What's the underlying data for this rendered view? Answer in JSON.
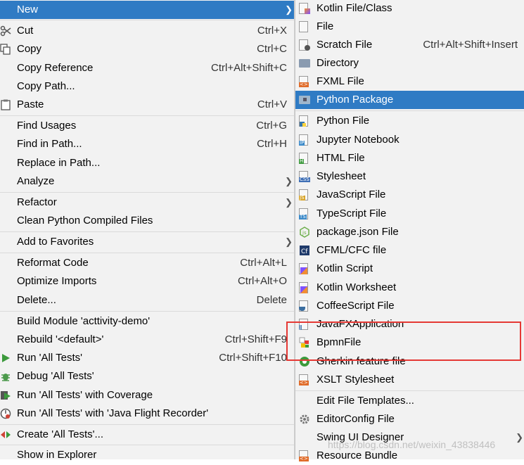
{
  "context_menu": {
    "items": [
      {
        "label": "New",
        "shortcut": "",
        "submenu": true,
        "selected": true
      },
      {
        "label": "Cut",
        "shortcut": "Ctrl+X",
        "icon": "scissors-icon"
      },
      {
        "label": "Copy",
        "shortcut": "Ctrl+C",
        "icon": "copy-icon"
      },
      {
        "label": "Copy Reference",
        "shortcut": "Ctrl+Alt+Shift+C"
      },
      {
        "label": "Copy Path...",
        "shortcut": ""
      },
      {
        "label": "Paste",
        "shortcut": "Ctrl+V",
        "icon": "clipboard-icon"
      },
      {
        "label": "Find Usages",
        "shortcut": "Ctrl+G"
      },
      {
        "label": "Find in Path...",
        "shortcut": "Ctrl+H"
      },
      {
        "label": "Replace in Path...",
        "shortcut": ""
      },
      {
        "label": "Analyze",
        "shortcut": "",
        "submenu": true
      },
      {
        "label": "Refactor",
        "shortcut": "",
        "submenu": true
      },
      {
        "label": "Clean Python Compiled Files",
        "shortcut": ""
      },
      {
        "label": "Add to Favorites",
        "shortcut": "",
        "submenu": true
      },
      {
        "label": "Reformat Code",
        "shortcut": "Ctrl+Alt+L"
      },
      {
        "label": "Optimize Imports",
        "shortcut": "Ctrl+Alt+O"
      },
      {
        "label": "Delete...",
        "shortcut": "Delete"
      },
      {
        "label": "Build Module 'acttivity-demo'",
        "shortcut": ""
      },
      {
        "label": "Rebuild '<default>'",
        "shortcut": "Ctrl+Shift+F9"
      },
      {
        "label": "Run 'All Tests'",
        "shortcut": "Ctrl+Shift+F10",
        "icon": "run-icon"
      },
      {
        "label": "Debug 'All Tests'",
        "shortcut": "",
        "icon": "debug-icon"
      },
      {
        "label": "Run 'All Tests' with Coverage",
        "shortcut": "",
        "icon": "coverage-icon"
      },
      {
        "label": "Run 'All Tests' with 'Java Flight Recorder'",
        "shortcut": "",
        "icon": "profiler-icon"
      },
      {
        "label": "Create 'All Tests'...",
        "shortcut": "",
        "icon": "create-test-icon"
      },
      {
        "label": "Show in Explorer",
        "shortcut": ""
      }
    ]
  },
  "submenu": {
    "items": [
      {
        "label": "Kotlin File/Class",
        "icon": "kotlin-file-icon"
      },
      {
        "label": "File",
        "icon": "file-icon"
      },
      {
        "label": "Scratch File",
        "shortcut": "Ctrl+Alt+Shift+Insert",
        "icon": "scratch-file-icon"
      },
      {
        "label": "Directory",
        "icon": "folder-icon"
      },
      {
        "label": "FXML File",
        "icon": "fxml-file-icon"
      },
      {
        "label": "Python Package",
        "icon": "package-folder-icon",
        "selected": true
      },
      {
        "label": "Python File",
        "icon": "python-file-icon"
      },
      {
        "label": "Jupyter Notebook",
        "icon": "jupyter-icon"
      },
      {
        "label": "HTML File",
        "icon": "html-file-icon"
      },
      {
        "label": "Stylesheet",
        "icon": "css-file-icon"
      },
      {
        "label": "JavaScript File",
        "icon": "js-file-icon"
      },
      {
        "label": "TypeScript File",
        "icon": "ts-file-icon"
      },
      {
        "label": "package.json File",
        "icon": "nodejs-icon"
      },
      {
        "label": "CFML/CFC file",
        "icon": "cfml-icon"
      },
      {
        "label": "Kotlin Script",
        "icon": "kotlin-script-icon"
      },
      {
        "label": "Kotlin Worksheet",
        "icon": "kotlin-worksheet-icon"
      },
      {
        "label": "CoffeeScript File",
        "icon": "coffeescript-icon"
      },
      {
        "label": "JavaFXApplication",
        "icon": "javafx-icon"
      },
      {
        "label": "BpmnFile",
        "icon": "bpmn-icon"
      },
      {
        "label": "Gherkin feature file",
        "icon": "gherkin-icon"
      },
      {
        "label": "XSLT Stylesheet",
        "icon": "xslt-icon"
      },
      {
        "label": "Edit File Templates...",
        "icon": ""
      },
      {
        "label": "EditorConfig File",
        "icon": "gear-icon"
      },
      {
        "label": "Swing UI Designer",
        "icon": "",
        "submenu": true
      },
      {
        "label": "Resource Bundle",
        "icon": "resource-bundle-icon"
      }
    ]
  },
  "watermark": "https://blog.csdn.net/weixin_43838446",
  "colors": {
    "selection": "#2f7bc4",
    "highlight_box": "#e53935",
    "menu_bg": "#f2f2f2"
  }
}
